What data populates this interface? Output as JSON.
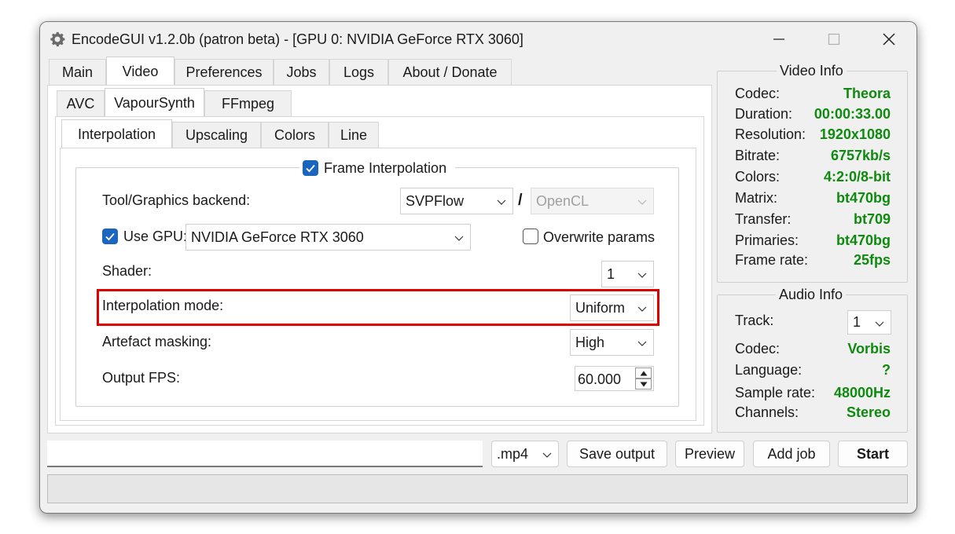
{
  "window": {
    "title": "EncodeGUI v1.2.0b (patron beta) - [GPU 0: NVIDIA GeForce RTX 3060]"
  },
  "main_tabs": [
    "Main",
    "Video",
    "Preferences",
    "Jobs",
    "Logs",
    "About / Donate"
  ],
  "video_subtabs": [
    "AVC",
    "VapourSynth",
    "FFmpeg"
  ],
  "vs_subtabs": [
    "Interpolation",
    "Upscaling",
    "Colors",
    "Line"
  ],
  "interp": {
    "group_title": "Frame Interpolation",
    "backend_label": "Tool/Graphics backend:",
    "backend_value": "SVPFlow",
    "slash": "/",
    "backend2_value": "OpenCL",
    "use_gpu_label": "Use GPU:",
    "gpu_value": "NVIDIA GeForce RTX 3060",
    "overwrite_label": "Overwrite params",
    "shader_label": "Shader:",
    "shader_value": "1",
    "mode_label": "Interpolation mode:",
    "mode_value": "Uniform",
    "artefact_label": "Artefact masking:",
    "artefact_value": "High",
    "fps_label": "Output FPS:",
    "fps_value": "60.000"
  },
  "video_info": {
    "title": "Video Info",
    "rows": [
      {
        "label": "Codec:",
        "value": "Theora"
      },
      {
        "label": "Duration:",
        "value": "00:00:33.00"
      },
      {
        "label": "Resolution:",
        "value": "1920x1080"
      },
      {
        "label": "Bitrate:",
        "value": "6757kb/s"
      },
      {
        "label": "Colors:",
        "value": "4:2:0/8-bit"
      },
      {
        "label": "Matrix:",
        "value": "bt470bg"
      },
      {
        "label": "Transfer:",
        "value": "bt709"
      },
      {
        "label": "Primaries:",
        "value": "bt470bg"
      },
      {
        "label": "Frame rate:",
        "value": "25fps"
      }
    ]
  },
  "audio_info": {
    "title": "Audio Info",
    "track_label": "Track:",
    "track_value": "1",
    "rows": [
      {
        "label": "Codec:",
        "value": "Vorbis"
      },
      {
        "label": "Language:",
        "value": "?"
      },
      {
        "label": "Sample rate:",
        "value": "48000Hz"
      },
      {
        "label": "Channels:",
        "value": "Stereo"
      }
    ]
  },
  "bottom": {
    "output_path": "",
    "container_value": ".mp4",
    "save_output_label": "Save output",
    "preview_label": "Preview",
    "add_job_label": "Add job",
    "start_label": "Start"
  },
  "colors": {
    "info_value": "#0f8a0f",
    "checkbox_checked": "#1a65c0",
    "highlight": "#e00000"
  }
}
